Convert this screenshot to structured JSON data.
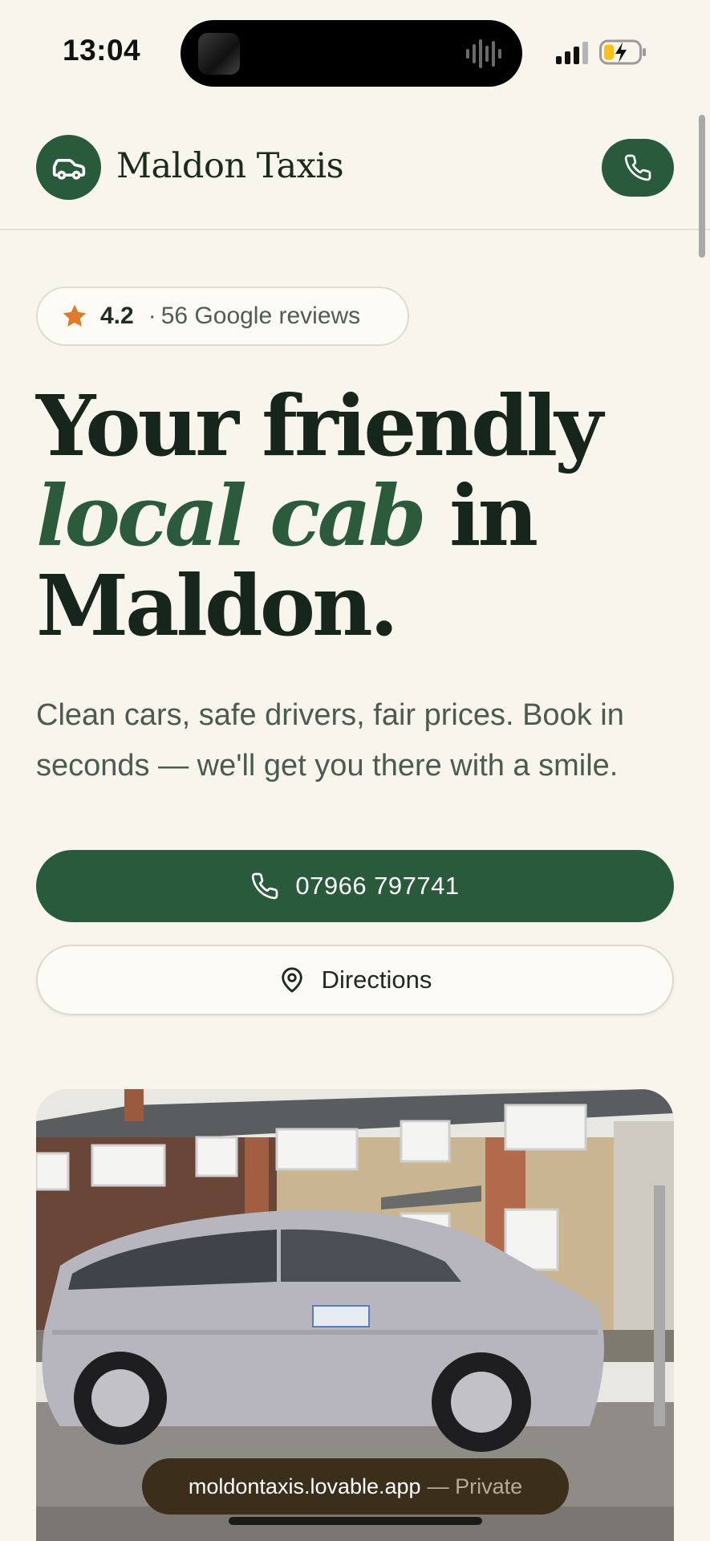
{
  "status_bar": {
    "time": "13:04",
    "icons": [
      "cellular-signal-icon",
      "battery-charging-icon"
    ]
  },
  "header": {
    "brand": "Maldon Taxis",
    "logo_icon": "car-icon",
    "call_icon": "phone-icon"
  },
  "rating": {
    "score": "4.2",
    "separator": "·",
    "reviews_text": "56 Google reviews",
    "icon": "star-icon"
  },
  "hero": {
    "title_line1": "Your friendly",
    "title_accent": "local cab",
    "title_line2_rest": " in",
    "title_line3": "Maldon.",
    "subtitle": "Clean cars, safe drivers, fair prices. Book in seconds — we'll get you there with a smile."
  },
  "actions": {
    "phone_label": "07966 797741",
    "directions_label": "Directions"
  },
  "browser": {
    "url": "moldontaxis.lovable.app",
    "private_label": "— Private"
  },
  "colors": {
    "brand_green": "#2a5a3c",
    "background": "#f8f5ec",
    "star": "#e07a2c"
  }
}
